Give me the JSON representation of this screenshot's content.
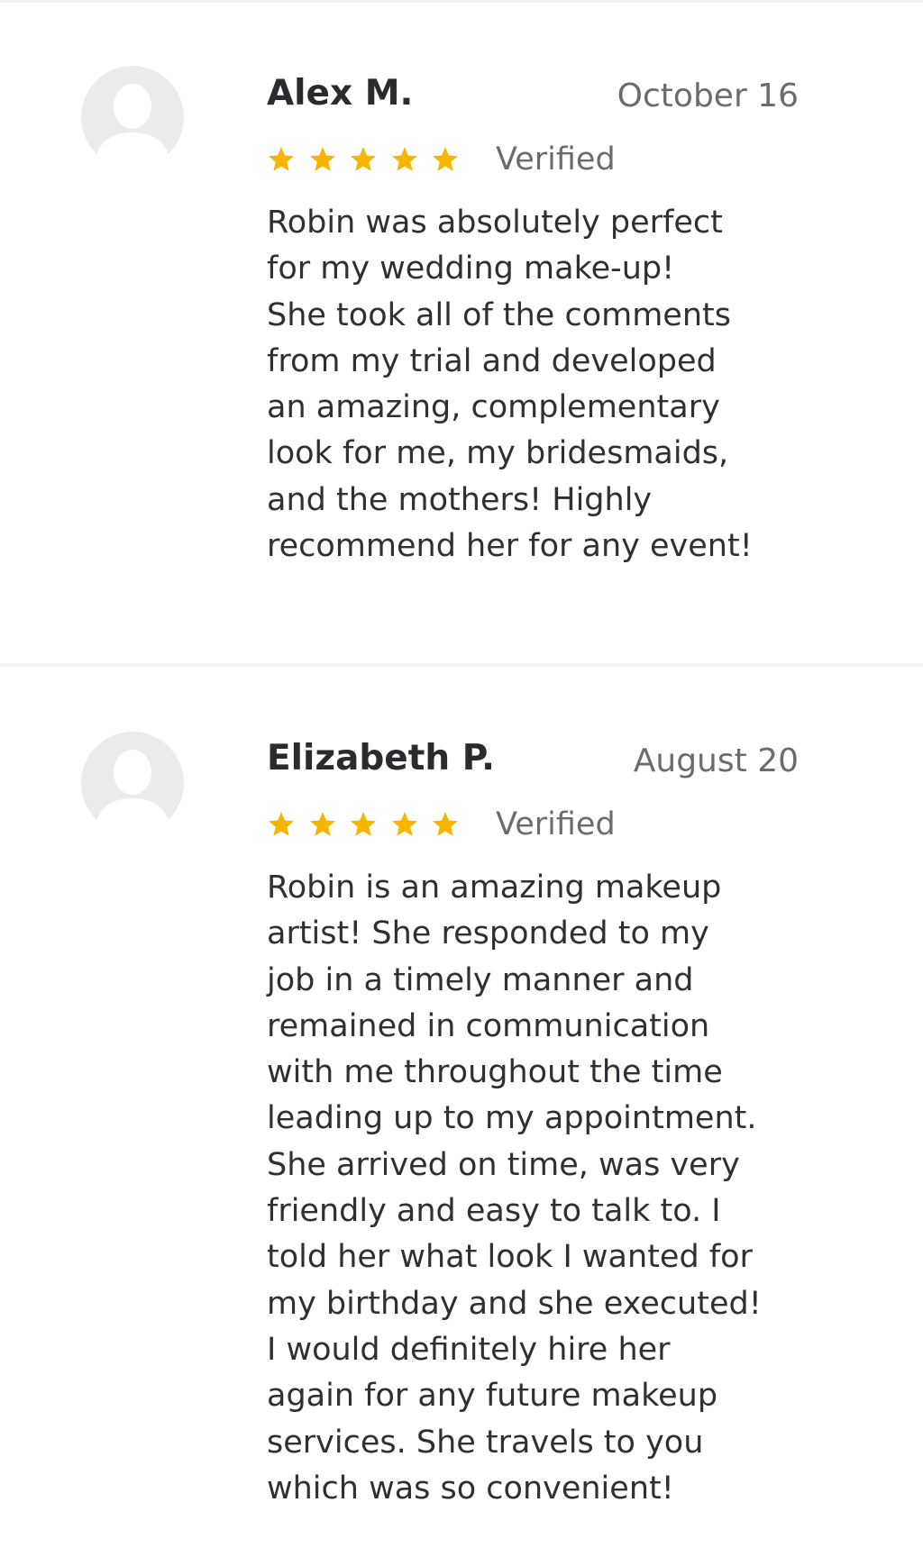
{
  "colors": {
    "star": "#f7b500",
    "avatar_bg": "#ebebeb",
    "avatar_fg": "#ffffff",
    "name_text": "#2a2b2e",
    "meta_text": "#6a6c70",
    "body_text": "#2f3033",
    "divider": "#f4f4f4"
  },
  "reviews": [
    {
      "avatar_icon": "user-placeholder-icon",
      "name": "Alex M.",
      "date": "October 16",
      "rating": 5,
      "verified_label": "Verified",
      "body_lines": [
        "Robin was absolutely perfect",
        "for my wedding make-up!",
        "She took all of the comments",
        "from my trial and developed",
        "an amazing, complementary",
        "look for me, my bridesmaids,",
        "and the mothers! Highly",
        "recommend her for any event!"
      ]
    },
    {
      "avatar_icon": "user-placeholder-icon",
      "name": "Elizabeth P.",
      "date": "August 20",
      "rating": 5,
      "verified_label": "Verified",
      "body_lines": [
        "Robin is an amazing makeup",
        "artist! She responded to my",
        "job in a timely manner and",
        "remained in communication",
        "with me throughout the time",
        "leading up to my appointment.",
        "She arrived on time, was very",
        "friendly and easy to talk to. I",
        "told her what look I wanted for",
        "my birthday and she executed!",
        "I would definitely hire her",
        "again for any future makeup",
        "services. She travels to you",
        "which was so convenient!"
      ]
    }
  ]
}
